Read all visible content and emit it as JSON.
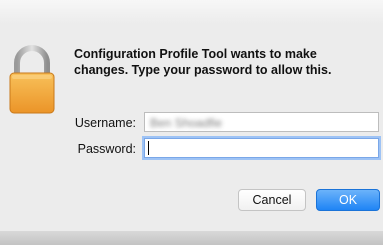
{
  "dialog": {
    "message": "Configuration Profile Tool wants to make changes. Type your password to allow this.",
    "username_label": "Username:",
    "username_value": "Ben Shoadfie",
    "password_label": "Password:",
    "password_value": "",
    "cancel_label": "Cancel",
    "ok_label": "OK"
  },
  "icons": {
    "lock": "lock-icon"
  },
  "colors": {
    "background": "#ececec",
    "lock_body": "#f3a93b",
    "lock_shackle": "#b9b9b9",
    "ok_button": "#1f84f5",
    "focus_ring": "#9ec3f5"
  }
}
